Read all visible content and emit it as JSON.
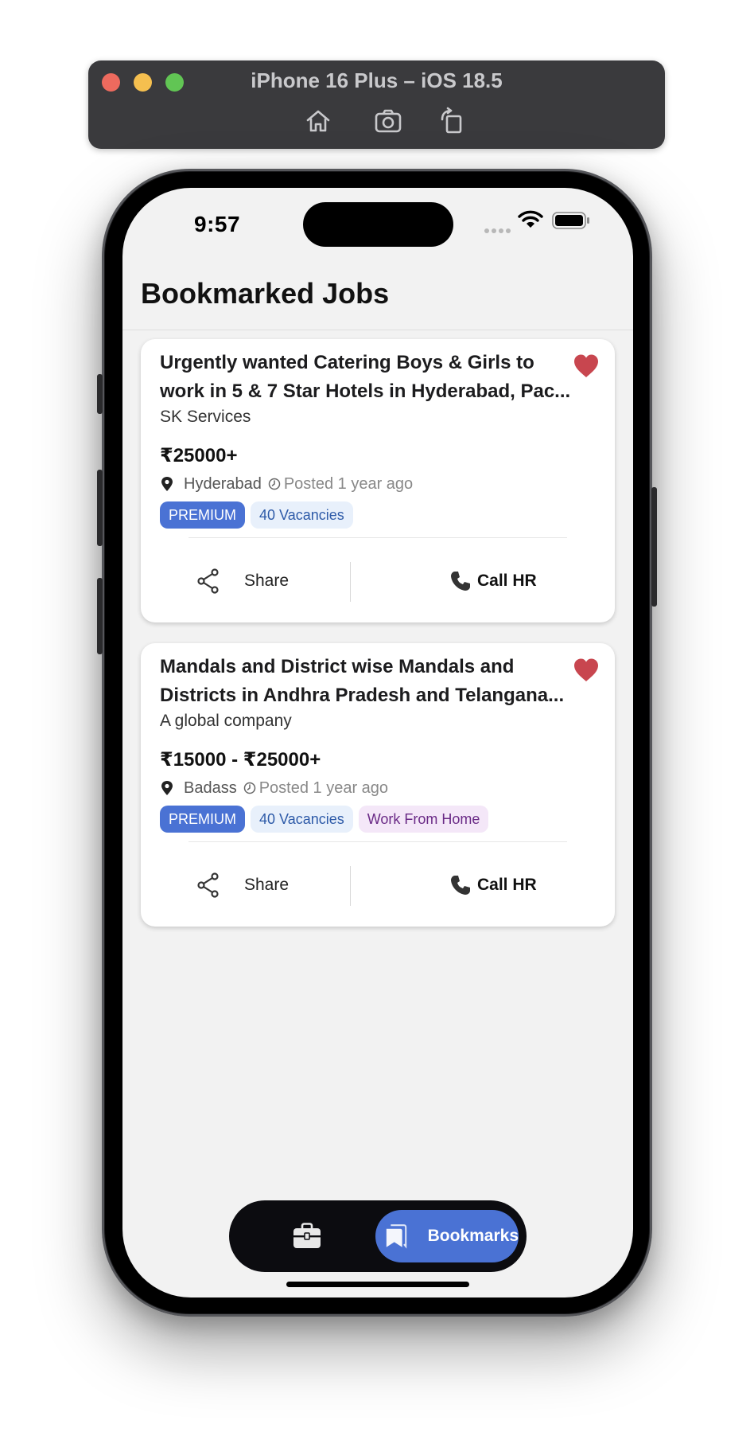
{
  "simulator": {
    "title": "iPhone 16 Plus – iOS 18.5",
    "tools": [
      "home-icon",
      "screenshot-icon",
      "rotate-icon"
    ]
  },
  "status_bar": {
    "time": "9:57"
  },
  "page": {
    "title": "Bookmarked Jobs"
  },
  "jobs": [
    {
      "title": "Urgently wanted Catering Boys & Girls to work in 5 & 7 Star Hotels in Hyderabad, Pac...",
      "company": "SK Services",
      "salary": "₹25000+",
      "location": "Hyderabad",
      "posted": "Posted 1 year ago",
      "tags": [
        "PREMIUM",
        "40 Vacancies"
      ],
      "share_label": "Share",
      "call_label": "Call HR"
    },
    {
      "title": "Mandals and District wise Mandals and Districts in Andhra Pradesh and Telangana...",
      "company": "A global company",
      "salary": "₹15000 - ₹25000+",
      "location": "Badass",
      "posted": "Posted 1 year ago",
      "tags": [
        "PREMIUM",
        "40 Vacancies",
        "Work From Home"
      ],
      "share_label": "Share",
      "call_label": "Call HR"
    }
  ],
  "tabbar": {
    "jobs_icon": "briefcase-icon",
    "bookmarks_label": "Bookmarks"
  },
  "colors": {
    "accent": "#4a72d4",
    "heart": "#c8464f",
    "premium_bg": "#4a72d4",
    "vacancies_bg": "#e8f0fb",
    "wfh_bg": "#f4e7f8"
  }
}
